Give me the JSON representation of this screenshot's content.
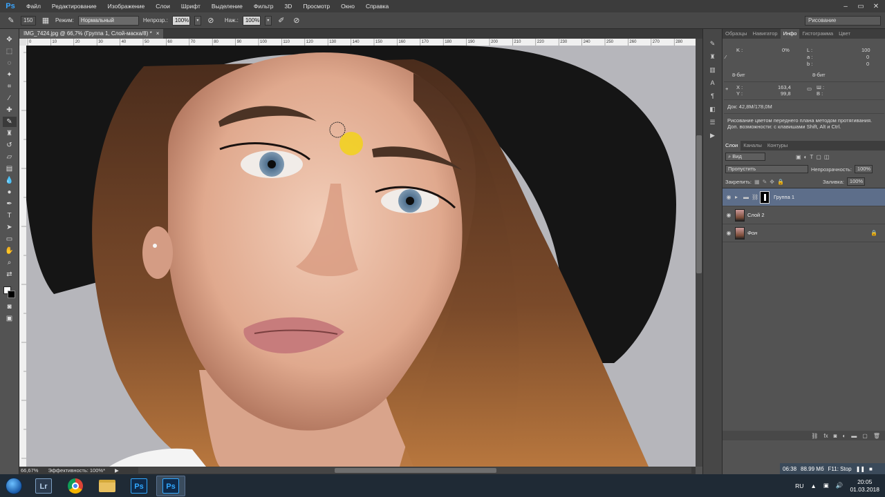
{
  "menubar": {
    "logo": "Ps",
    "items": [
      "Файл",
      "Редактирование",
      "Изображение",
      "Слои",
      "Шрифт",
      "Выделение",
      "Фильтр",
      "3D",
      "Просмотр",
      "Окно",
      "Справка"
    ]
  },
  "options": {
    "brush_size": "150",
    "mode_label": "Режим:",
    "mode_value": "Нормальный",
    "opacity_label": "Непрозр.:",
    "opacity_value": "100%",
    "flow_label": "Наж.:",
    "flow_value": "100%",
    "workspace": "Рисование"
  },
  "document": {
    "tab_title": "IMG_7424.jpg @ 66,7% (Группа 1, Слой-маска/8) *",
    "ruler_ticks": [
      "0",
      "10",
      "20",
      "30",
      "40",
      "50",
      "60",
      "70",
      "80",
      "90",
      "100",
      "110",
      "120",
      "130",
      "140",
      "150",
      "160",
      "170",
      "180",
      "190",
      "200",
      "210",
      "220",
      "230",
      "240",
      "250",
      "260",
      "270",
      "280"
    ],
    "zoom": "66,67%",
    "efficiency": "Эффективность: 100%*"
  },
  "info_panel": {
    "tabs": [
      "Образцы",
      "Навигатор",
      "Инфо",
      "Гистограмма",
      "Цвет"
    ],
    "active_tab": "Инфо",
    "k_label": "K :",
    "k_value": "0%",
    "l_label": "L :",
    "l_value": "100",
    "a_label": "a :",
    "a_value": "0",
    "b_label": "b :",
    "b_value": "0",
    "bits_left": "8-бит",
    "bits_right": "8-бит",
    "x_label": "X :",
    "x_value": "163,4",
    "y_label": "Y :",
    "y_value": "99,8",
    "w_label": "Ш :",
    "h_label": "В :",
    "doc_size": "Док: 42,8M/178,0M",
    "hint_line1": "Рисование цветом переднего плана методом протягивания.",
    "hint_line2": "Доп. возможности: с клавишами Shift, Alt и Ctrl."
  },
  "layers_panel": {
    "tabs": [
      "Слои",
      "Каналы",
      "Контуры"
    ],
    "active_tab": "Слои",
    "filter_label": "Вид",
    "blend_mode": "Пропустить",
    "opacity_label": "Непрозрачность:",
    "opacity_value": "100%",
    "lock_label": "Закрепить:",
    "fill_label": "Заливка:",
    "fill_value": "100%",
    "layers": [
      {
        "name": "Группа 1",
        "selected": true,
        "type": "group"
      },
      {
        "name": "Слой 2",
        "selected": false,
        "type": "layer"
      },
      {
        "name": "Фон",
        "selected": false,
        "type": "background"
      }
    ]
  },
  "recorder": {
    "time": "06:38",
    "size": "88.99 Мб",
    "hint": "F11: Stop"
  },
  "taskbar": {
    "apps": [
      {
        "name": "Lightroom",
        "label": "Lr"
      },
      {
        "name": "Chrome",
        "label": ""
      },
      {
        "name": "Explorer",
        "label": ""
      },
      {
        "name": "Photoshop",
        "label": "Ps"
      },
      {
        "name": "Photoshop (active)",
        "label": "Ps"
      }
    ],
    "lang": "RU",
    "time": "20:05",
    "date": "01.03.2018"
  }
}
